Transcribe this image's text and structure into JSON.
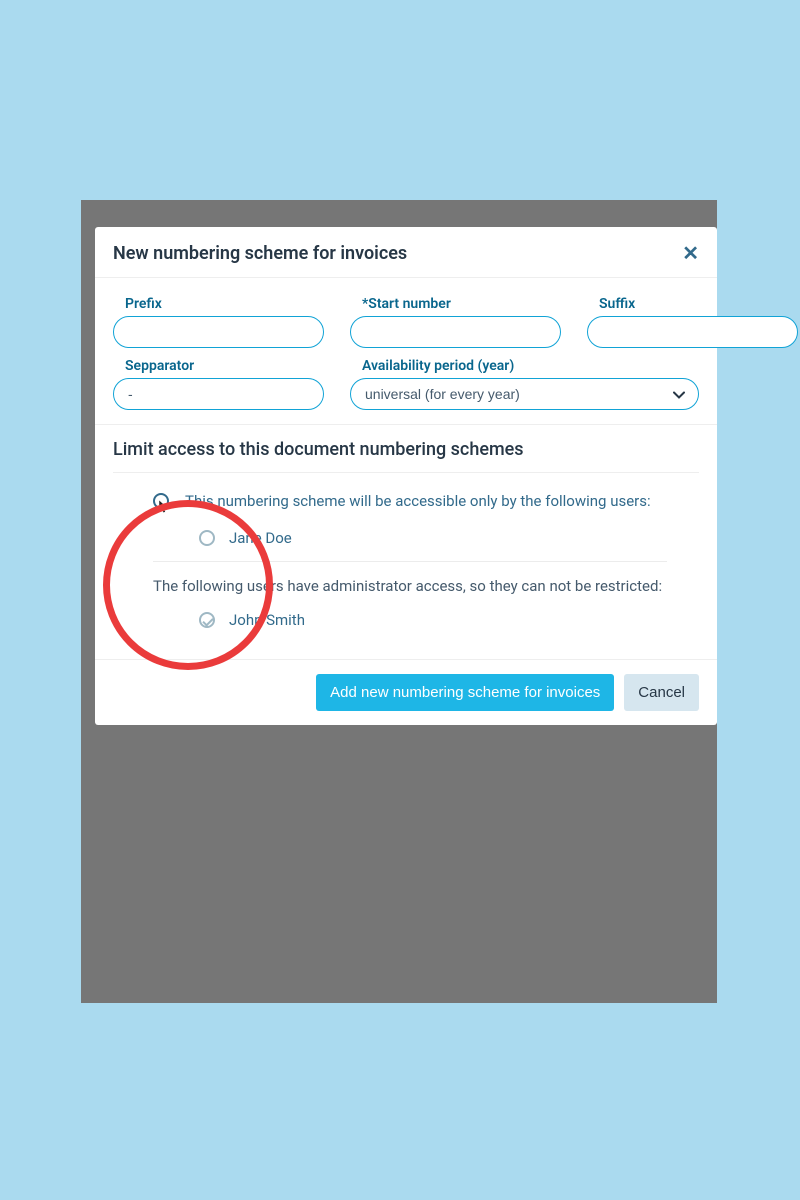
{
  "modal": {
    "title": "New numbering scheme for invoices",
    "close": "✕"
  },
  "fields": {
    "prefix": {
      "label": "Prefix",
      "value": ""
    },
    "start_number": {
      "label": "*Start number",
      "value": ""
    },
    "suffix": {
      "label": "Suffix",
      "value": ""
    },
    "separator": {
      "label": "Sepparator",
      "value": "-"
    },
    "availability": {
      "label": "Availability period (year)",
      "value": "universal (for every year)"
    }
  },
  "access": {
    "title": "Limit access to this document numbering schemes",
    "intro": "This numbering scheme will be accessible only by the following users:",
    "users": [
      {
        "name": "Jane Doe"
      }
    ],
    "admin_note": "The following users have administrator access, so they can not be restricted:",
    "admins": [
      {
        "name": "John Smith"
      }
    ]
  },
  "footer": {
    "primary": "Add new numbering scheme for invoices",
    "cancel": "Cancel"
  }
}
